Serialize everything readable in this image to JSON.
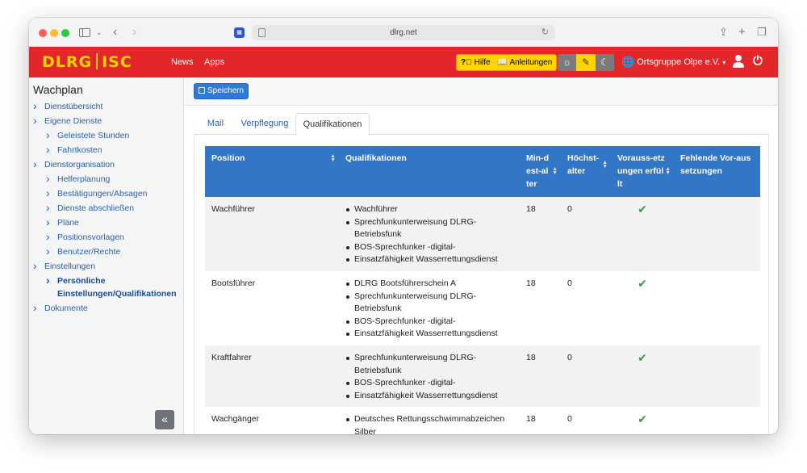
{
  "browser": {
    "url": "dlrg.net"
  },
  "header": {
    "logo_left": "DLRG",
    "logo_right": "ISC",
    "nav": [
      "News",
      "Apps"
    ],
    "help_label": "Hilfe",
    "guides_label": "Anleitungen",
    "org_label": "Ortsgruppe Olpe e.V.",
    "colors": {
      "bar": "#e3262a",
      "accent": "#ffd400"
    }
  },
  "sidebar": {
    "title": "Wachplan",
    "items": [
      {
        "label": "Dienstübersicht",
        "level": 0
      },
      {
        "label": "Eigene Dienste",
        "level": 0
      },
      {
        "label": "Geleistete Stunden",
        "level": 1
      },
      {
        "label": "Fahrtkosten",
        "level": 1
      },
      {
        "label": "Dienstorganisation",
        "level": 0
      },
      {
        "label": "Helferplanung",
        "level": 1
      },
      {
        "label": "Bestätigungen/Absagen",
        "level": 1
      },
      {
        "label": "Dienste abschließen",
        "level": 1
      },
      {
        "label": "Pläne",
        "level": 1
      },
      {
        "label": "Positionsvorlagen",
        "level": 1
      },
      {
        "label": "Benutzer/Rechte",
        "level": 1
      },
      {
        "label": "Einstellungen",
        "level": 0
      },
      {
        "label": "Persönliche Einstellungen/Qualifikationen",
        "level": 1,
        "active": true
      },
      {
        "label": "Dokumente",
        "level": 0
      }
    ],
    "collapse_label": "«"
  },
  "toolbar": {
    "save_label": "Speichern"
  },
  "tabs": [
    {
      "label": "Mail"
    },
    {
      "label": "Verpflegung"
    },
    {
      "label": "Qualifikationen",
      "active": true
    }
  ],
  "table": {
    "headers": {
      "position": "Position",
      "quals": "Qualifikationen",
      "min_age": "Min-dest-alter",
      "max_age": "Höchst-alter",
      "prereq": "Vorauss-etzungen erfüllt",
      "missing": "Fehlende Vor-aussetzungen"
    },
    "rows": [
      {
        "position": "Wachführer",
        "quals": [
          "Wachführer",
          "Sprechfunkunterweisung DLRG-Betriebsfunk",
          "BOS-Sprechfunker -digital-",
          "Einsatzfähigkeit Wasserrettungsdienst"
        ],
        "min_age": "18",
        "max_age": "0",
        "fulfilled": true,
        "missing": ""
      },
      {
        "position": "Bootsführer",
        "quals": [
          "DLRG Bootsführerschein A",
          "Sprechfunkunterweisung DLRG-Betriebsfunk",
          "BOS-Sprechfunker -digital-",
          "Einsatzfähigkeit Wasserrettungsdienst"
        ],
        "min_age": "18",
        "max_age": "0",
        "fulfilled": true,
        "missing": ""
      },
      {
        "position": "Kraftfahrer",
        "quals": [
          "Sprechfunkunterweisung DLRG-Betriebsfunk",
          "BOS-Sprechfunker -digital-",
          "Einsatzfähigkeit Wasserrettungsdienst"
        ],
        "min_age": "18",
        "max_age": "0",
        "fulfilled": true,
        "missing": ""
      },
      {
        "position": "Wachgänger",
        "quals": [
          "Deutsches Rettungsschwimmabzeichen Silber"
        ],
        "min_age": "18",
        "max_age": "0",
        "fulfilled": true,
        "missing": ""
      }
    ]
  }
}
